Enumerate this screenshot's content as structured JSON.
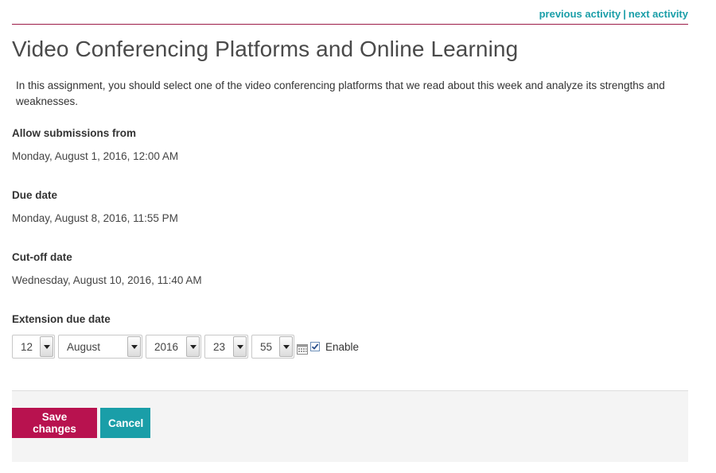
{
  "nav": {
    "previous_label": "previous activity",
    "separator": "|",
    "next_label": "next activity"
  },
  "page": {
    "title": "Video Conferencing Platforms and Online Learning",
    "intro": "In this assignment, you should select one of the video conferencing platforms that we read about this week and analyze its strengths and weaknesses."
  },
  "fields": {
    "allow_from": {
      "label": "Allow submissions from",
      "value": "Monday, August 1, 2016, 12:00 AM"
    },
    "due_date": {
      "label": "Due date",
      "value": "Monday, August 8, 2016, 11:55 PM"
    },
    "cutoff": {
      "label": "Cut-off date",
      "value": "Wednesday, August 10, 2016, 11:40 AM"
    },
    "extension": {
      "label": "Extension due date",
      "day": "12",
      "month": "August",
      "year": "2016",
      "hour": "23",
      "minute": "55",
      "enable_label": "Enable",
      "enabled": true
    }
  },
  "buttons": {
    "save": "Save changes",
    "cancel": "Cancel"
  },
  "colors": {
    "accent_teal": "#1a9ea8",
    "accent_crimson": "#b8124f",
    "rule": "#9c1b47"
  }
}
